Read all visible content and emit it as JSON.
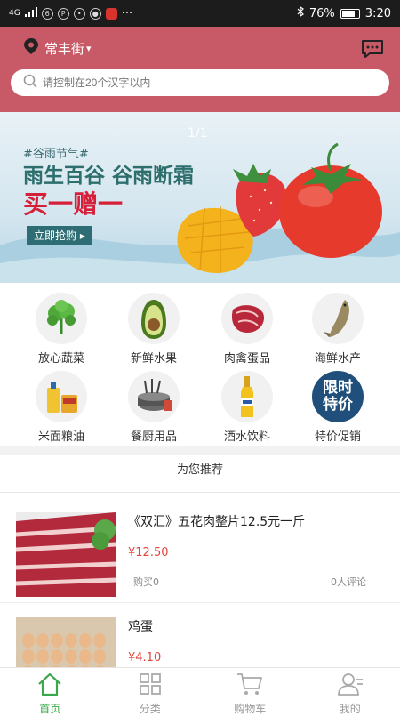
{
  "status_bar": {
    "network": "4G",
    "battery": "76%",
    "battery_level": 0.76,
    "time": "3:20",
    "more": "···"
  },
  "header": {
    "location": "常丰街",
    "location_caret": "▾",
    "search_placeholder": "请控制在20个汉字以内"
  },
  "banner": {
    "page_indicator": "1/1",
    "tag": "#谷雨节气#",
    "title": "雨生百谷  谷雨断霜",
    "offer": "买一赠一",
    "button": "立即抢购 ▸"
  },
  "categories": [
    {
      "label": "放心蔬菜",
      "icon": "vegetable-icon"
    },
    {
      "label": "新鲜水果",
      "icon": "avocado-icon"
    },
    {
      "label": "肉禽蛋品",
      "icon": "meat-icon"
    },
    {
      "label": "海鲜水产",
      "icon": "fish-icon"
    },
    {
      "label": "米面粮油",
      "icon": "grain-oil-icon"
    },
    {
      "label": "餐厨用品",
      "icon": "kitchenware-icon"
    },
    {
      "label": "酒水饮料",
      "icon": "beverage-icon"
    },
    {
      "label": "特价促销",
      "icon": "promotion-icon",
      "badge_line1": "限时",
      "badge_line2": "特价"
    }
  ],
  "recommend_title": "为您推荐",
  "products": [
    {
      "name": "《双汇》五花肉整片12.5元一斤",
      "price": "¥12.50",
      "sold": "购买0",
      "comments": "0人评论"
    },
    {
      "name": "鸡蛋",
      "price": "¥4.10"
    }
  ],
  "tabbar": [
    {
      "label": "首页",
      "icon": "home-icon",
      "active": true
    },
    {
      "label": "分类",
      "icon": "category-grid-icon",
      "active": false
    },
    {
      "label": "购物车",
      "icon": "cart-icon",
      "active": false
    },
    {
      "label": "我的",
      "icon": "profile-icon",
      "active": false
    }
  ],
  "colors": {
    "header": "#c75a66",
    "accent_green": "#3aa84a",
    "price_red": "#e2453c",
    "status_bar": "#1c1c1c"
  }
}
